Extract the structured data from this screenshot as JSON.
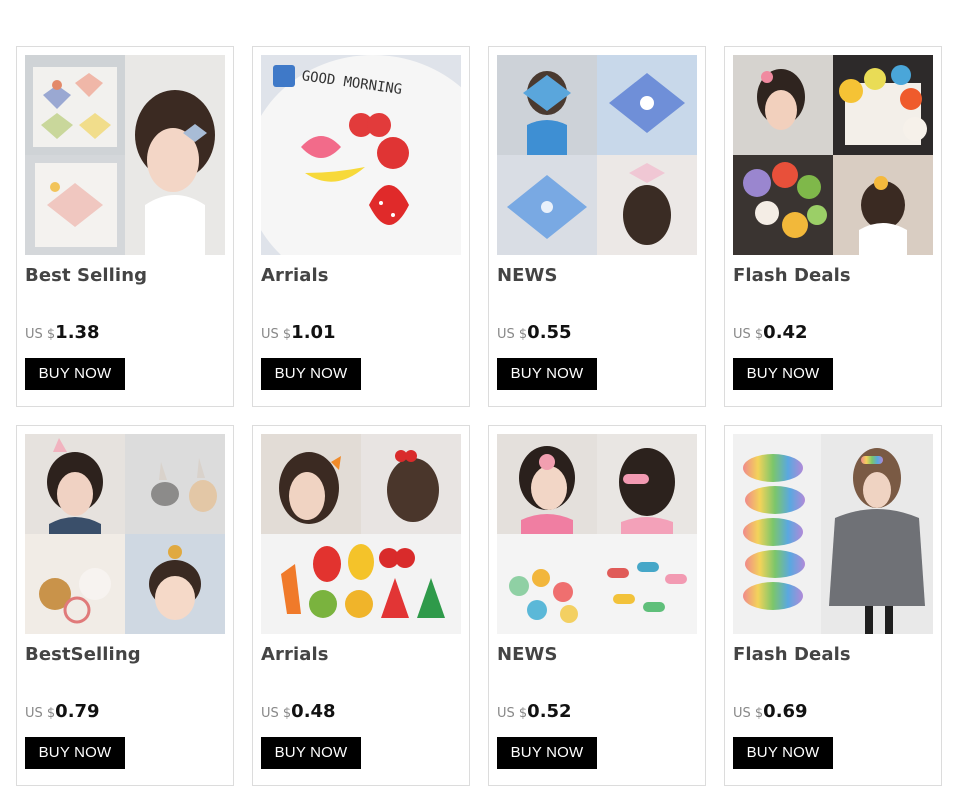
{
  "products": [
    {
      "title": "Best Selling",
      "currency": "US $",
      "price": "1.38",
      "button": "BUY NOW",
      "image": "bow-clips-girl-photo"
    },
    {
      "title": "Arrials",
      "currency": "US $",
      "price": "1.01",
      "button": "BUY NOW",
      "image": "fruit-snap-clips-plate-photo",
      "image_text": "GOOD MORNING"
    },
    {
      "title": "NEWS",
      "currency": "US $",
      "price": "0.55",
      "button": "BUY NOW",
      "image": "blue-tulle-bow-photo"
    },
    {
      "title": "Flash Deals",
      "currency": "US $",
      "price": "0.42",
      "button": "BUY NOW",
      "image": "flower-clips-girl-photo"
    },
    {
      "title": "BestSelling",
      "currency": "US $",
      "price": "0.79",
      "button": "BUY NOW",
      "image": "bunny-hair-ties-photo"
    },
    {
      "title": "Arrials",
      "currency": "US $",
      "price": "0.48",
      "button": "BUY NOW",
      "image": "fruit-felt-clips-photo"
    },
    {
      "title": "NEWS",
      "currency": "US $",
      "price": "0.52",
      "button": "BUY NOW",
      "image": "knit-clips-girl-photo"
    },
    {
      "title": "Flash Deals",
      "currency": "US $",
      "price": "0.69",
      "button": "BUY NOW",
      "image": "rainbow-glitter-clips-photo"
    }
  ],
  "colors": {
    "button_bg": "#000000",
    "button_text": "#ffffff",
    "title_text": "#444444",
    "card_border": "#dcdcdc",
    "currency_text": "#888888"
  }
}
